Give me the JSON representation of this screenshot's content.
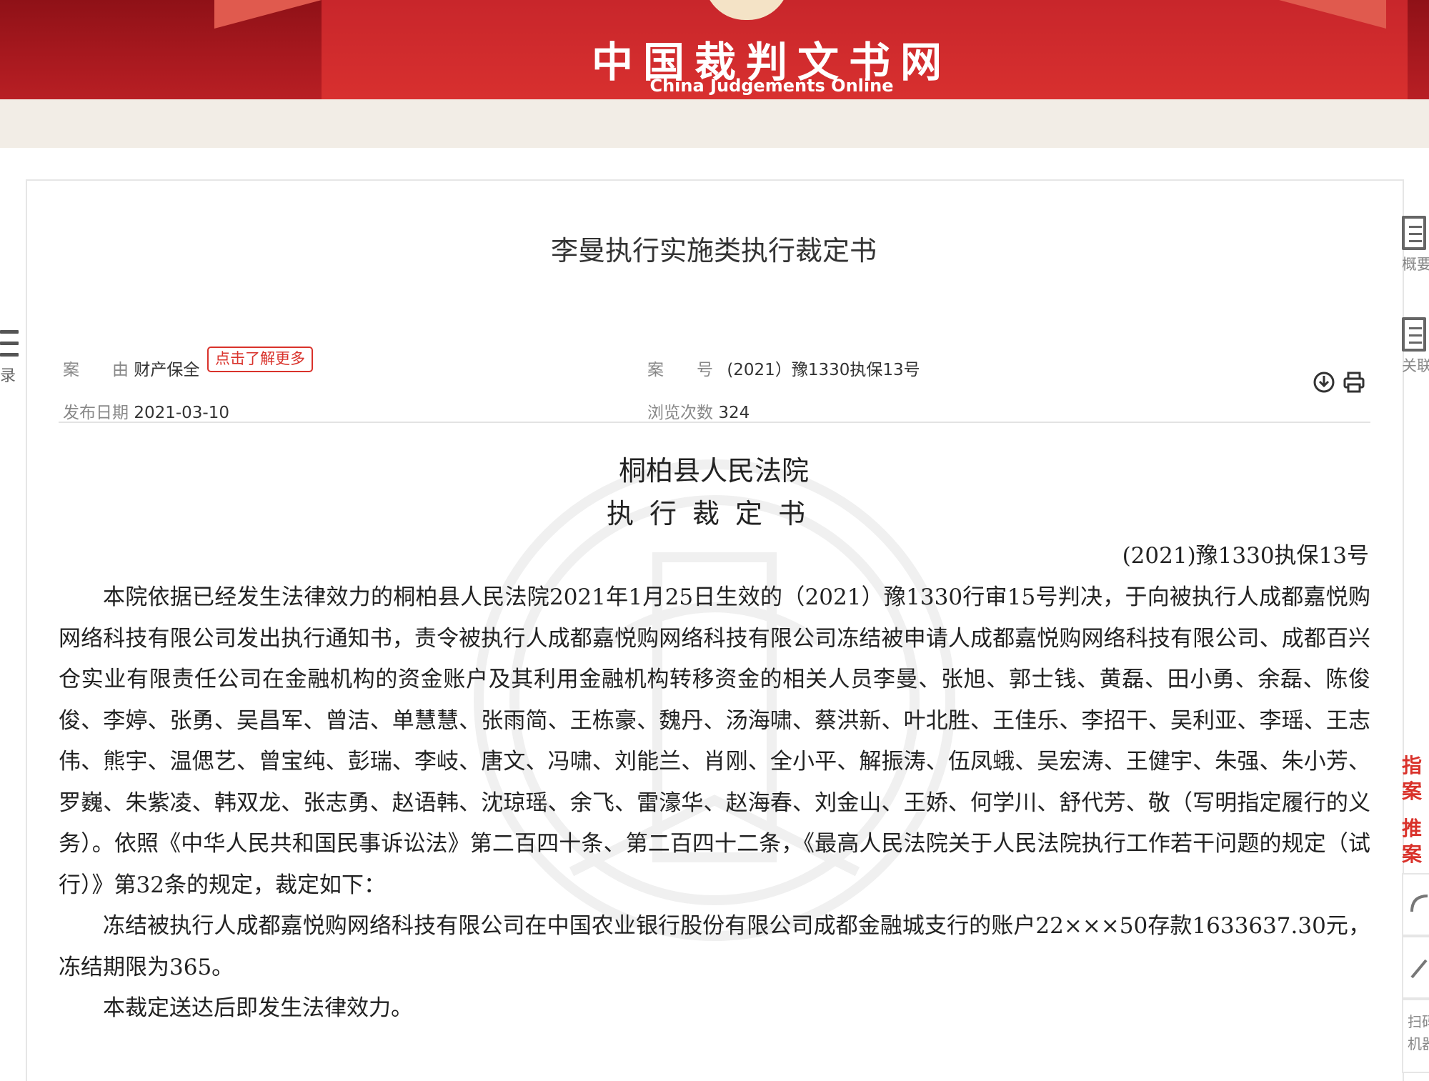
{
  "header": {
    "site_title": "中国裁判文书网",
    "site_subtitle": "China Judgements Online"
  },
  "sidebar_left": {
    "catalog_label": "录"
  },
  "document": {
    "title": "李曼执行实施类执行裁定书",
    "meta": {
      "cause_key": "案　　由",
      "cause_value": "财产保全",
      "learn_more": "点击了解更多",
      "case_no_key": "案　　号",
      "case_no_value": "(2021）豫1330执保13号",
      "date_key": "发布日期",
      "date_value": "2021-03-10",
      "views_key": "浏览次数",
      "views_value": "324"
    },
    "court": "桐柏县人民法院",
    "doc_type": "执行裁定书",
    "case_ref": "(2021)豫1330执保13号",
    "paragraphs": [
      "本院依据已经发生法律效力的桐柏县人民法院2021年1月25日生效的（2021）豫1330行审15号判决，于向被执行人成都嘉悦购网络科技有限公司发出执行通知书，责令被执行人成都嘉悦购网络科技有限公司冻结被申请人成都嘉悦购网络科技有限公司、成都百兴仓实业有限责任公司在金融机构的资金账户及其利用金融机构转移资金的相关人员李曼、张旭、郭士钱、黄磊、田小勇、余磊、陈俊俊、李婷、张勇、吴昌军、曾洁、单慧慧、张雨简、王栋豪、魏丹、汤海啸、蔡洪新、叶北胜、王佳乐、李招干、吴利亚、李瑶、王志伟、熊宇、温偲艺、曾宝纯、彭瑞、李岐、唐文、冯啸、刘能兰、肖刚、全小平、解振涛、伍凤蛾、吴宏涛、王健宇、朱强、朱小芳、罗巍、朱紫凌、韩双龙、张志勇、赵语韩、沈琼瑶、余飞、雷濠华、赵海春、刘金山、王娇、何学川、舒代芳、敬（写明指定履行的义务）。依照《中华人民共和国民事诉讼法》第二百四十条、第二百四十二条，《最高人民法院关于人民法院执行工作若干问题的规定（试行）》第32条的规定，裁定如下：",
      "冻结被执行人成都嘉悦购网络科技有限公司在中国农业银行股份有限公司成都金融城支行的账户22×××50存款1633637.30元，冻结期限为365。",
      "本裁定送达后即发生法律效力。"
    ]
  },
  "sidebar_right": {
    "overview_label": "概要",
    "related_label": "关联",
    "guide_label_1": "指",
    "guide_label_2": "案",
    "recommend_label_1": "推",
    "recommend_label_2": "案",
    "scan_label_1": "扫码",
    "scan_label_2": "机器"
  },
  "colors": {
    "banner_red": "#c8262b",
    "accent_red": "#d9322b"
  }
}
